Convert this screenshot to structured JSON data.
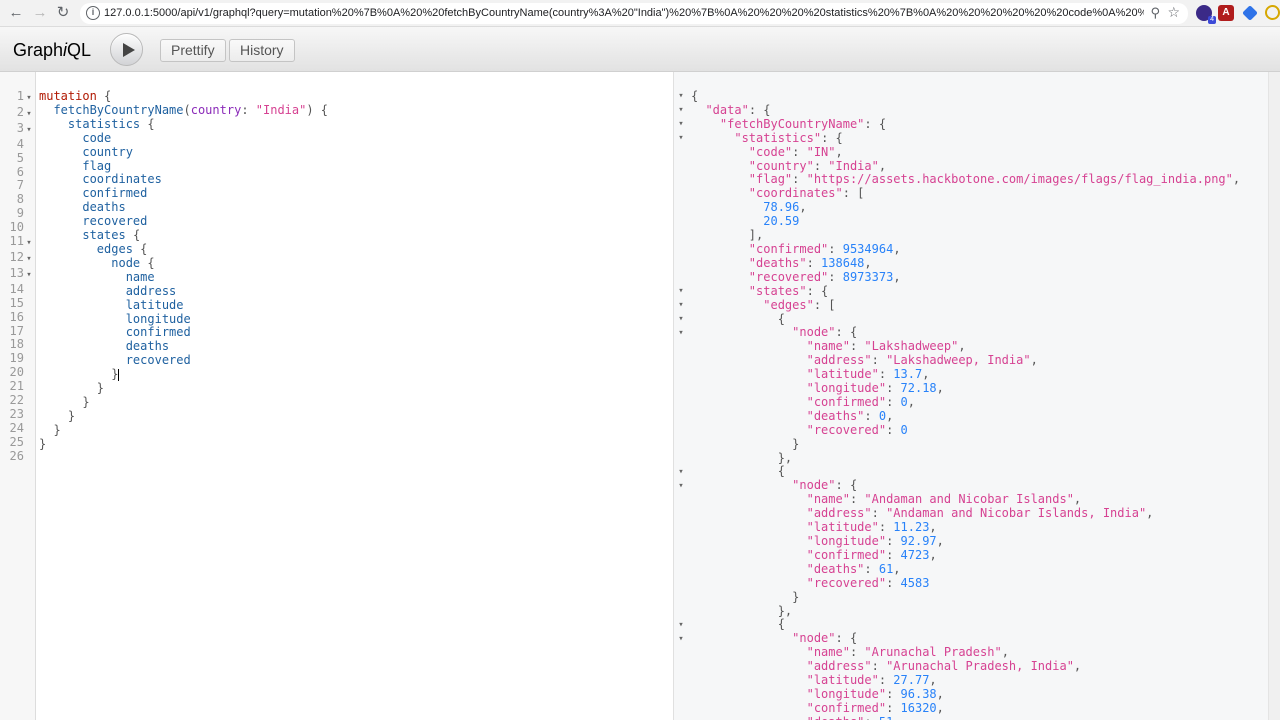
{
  "browser": {
    "url": "127.0.0.1:5000/api/v1/graphql?query=mutation%20%7B%0A%20%20fetchByCountryName(country%3A%20\"India\")%20%7B%0A%20%20%20%20statistics%20%7B%0A%20%20%20%20%20%20code%0A%20%20%2...",
    "ext_badge": "4",
    "ext_pdf": "A"
  },
  "toolbar": {
    "logo_pre": "Graph",
    "logo_i": "i",
    "logo_post": "QL",
    "prettify_label": "Prettify",
    "history_label": "History"
  },
  "query_line_numbers": [
    "1",
    "2",
    "3",
    "4",
    "5",
    "6",
    "7",
    "8",
    "9",
    "10",
    "11",
    "12",
    "13",
    "14",
    "15",
    "16",
    "17",
    "18",
    "19",
    "20",
    "21",
    "22",
    "23",
    "24",
    "25",
    "26"
  ],
  "query": {
    "kw": "mutation",
    "op": "fetchByCountryName",
    "arg": "country",
    "argval": "\"India\"",
    "statistics": "statistics",
    "fields1": [
      "code",
      "country",
      "flag",
      "coordinates",
      "confirmed",
      "deaths",
      "recovered"
    ],
    "states": "states",
    "edges": "edges",
    "node": "node",
    "fields2": [
      "name",
      "address",
      "latitude",
      "longitude",
      "confirmed",
      "deaths",
      "recovered"
    ]
  },
  "result": {
    "data": "\"data\"",
    "fetch": "\"fetchByCountryName\"",
    "statistics": "\"statistics\"",
    "code_k": "\"code\"",
    "code_v": "\"IN\"",
    "country_k": "\"country\"",
    "country_v": "\"India\"",
    "flag_k": "\"flag\"",
    "flag_v": "\"https://assets.hackbotone.com/images/flags/flag_india.png\"",
    "coords_k": "\"coordinates\"",
    "coord1": "78.96",
    "coord2": "20.59",
    "confirmed_k": "\"confirmed\"",
    "confirmed_v": "9534964",
    "deaths_k": "\"deaths\"",
    "deaths_v": "138648",
    "recovered_k": "\"recovered\"",
    "recovered_v": "8973373",
    "states_k": "\"states\"",
    "edges_k": "\"edges\"",
    "node_k": "\"node\"",
    "k_name": "\"name\"",
    "k_address": "\"address\"",
    "k_lat": "\"latitude\"",
    "k_lon": "\"longitude\"",
    "k_conf": "\"confirmed\"",
    "k_deaths": "\"deaths\"",
    "k_rec": "\"recovered\"",
    "nodes": [
      {
        "name": "\"Lakshadweep\"",
        "address": "\"Lakshadweep, India\"",
        "latitude": "13.7",
        "longitude": "72.18",
        "confirmed": "0",
        "deaths": "0",
        "recovered": "0"
      },
      {
        "name": "\"Andaman and Nicobar Islands\"",
        "address": "\"Andaman and Nicobar Islands, India\"",
        "latitude": "11.23",
        "longitude": "92.97",
        "confirmed": "4723",
        "deaths": "61",
        "recovered": "4583"
      },
      {
        "name": "\"Arunachal Pradesh\"",
        "address": "\"Arunachal Pradesh, India\"",
        "latitude": "27.77",
        "longitude": "96.38",
        "confirmed": "16320",
        "deaths": "51"
      }
    ]
  }
}
